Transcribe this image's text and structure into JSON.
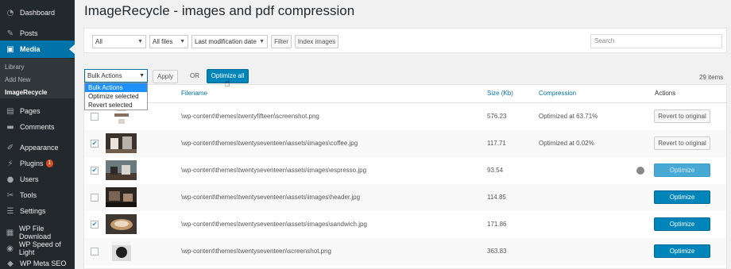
{
  "sidebar": {
    "items": [
      {
        "label": "Dashboard",
        "icon": "dashboard-icon",
        "glyph": "◔"
      },
      {
        "label": "Posts",
        "icon": "pushpin-icon",
        "glyph": "✎"
      },
      {
        "label": "Media",
        "icon": "media-icon",
        "glyph": "▣"
      },
      {
        "label": "Pages",
        "icon": "pages-icon",
        "glyph": "▤"
      },
      {
        "label": "Comments",
        "icon": "comments-icon",
        "glyph": "▬"
      },
      {
        "label": "Appearance",
        "icon": "paintbrush-icon",
        "glyph": "✐"
      },
      {
        "label": "Plugins",
        "icon": "plugins-icon",
        "glyph": "⚡",
        "badge": "1"
      },
      {
        "label": "Users",
        "icon": "users-icon",
        "glyph": "●"
      },
      {
        "label": "Tools",
        "icon": "tools-icon",
        "glyph": "✂"
      },
      {
        "label": "Settings",
        "icon": "settings-icon",
        "glyph": "☰"
      },
      {
        "label": "WP File Download",
        "icon": "download-icon",
        "glyph": "▦"
      },
      {
        "label": "WP Speed of Light",
        "icon": "speed-icon",
        "glyph": "◉"
      },
      {
        "label": "WP Meta SEO",
        "icon": "seo-icon",
        "glyph": "◆"
      }
    ],
    "submenu": [
      "Library",
      "Add New",
      "ImageRecycle"
    ]
  },
  "page_title": "ImageRecycle - images and pdf compression",
  "filters": {
    "type_select": "All",
    "files_select": "All files",
    "date_select": "Last modification date",
    "filter_button": "Filter",
    "index_button": "Index images",
    "search_placeholder": "Search"
  },
  "bulk": {
    "selected": "Bulk Actions",
    "options": [
      "Bulk Actions",
      "Optimize selected",
      "Revert selected"
    ],
    "apply": "Apply",
    "or": "OR",
    "optimize_all": "Optimize all",
    "items_count": "29 items"
  },
  "table": {
    "columns": {
      "filename": "Filename",
      "size": "Size (Kb)",
      "compression": "Compression",
      "actions": "Actions"
    },
    "rows": [
      {
        "checked": false,
        "filename": "\\wp-content\\themes\\twentyfifteen\\screenshot.png",
        "size": "576.23",
        "compression": "Optimized at 63.71%",
        "action": "Revert to original",
        "action_type": "revert",
        "thumb": "thumb-1"
      },
      {
        "checked": true,
        "filename": "\\wp-content\\themes\\twentyseventeen\\assets\\images\\coffee.jpg",
        "size": "117.71",
        "compression": "Optimized at 0.02%",
        "action": "Revert to original",
        "action_type": "revert",
        "thumb": "thumb-2"
      },
      {
        "checked": true,
        "filename": "\\wp-content\\themes\\twentyseventeen\\assets\\images\\espresso.jpg",
        "size": "93.54",
        "compression": "",
        "action": "Optimize",
        "action_type": "optimize-busy",
        "thumb": "thumb-3"
      },
      {
        "checked": false,
        "filename": "\\wp-content\\themes\\twentyseventeen\\assets\\images\\header.jpg",
        "size": "114.85",
        "compression": "",
        "action": "Optimize",
        "action_type": "optimize",
        "thumb": "thumb-4"
      },
      {
        "checked": true,
        "filename": "\\wp-content\\themes\\twentyseventeen\\assets\\images\\sandwich.jpg",
        "size": "171.86",
        "compression": "",
        "action": "Optimize",
        "action_type": "optimize",
        "thumb": "thumb-5"
      },
      {
        "checked": false,
        "filename": "\\wp-content\\themes\\twentyseventeen\\screenshot.png",
        "size": "363.83",
        "compression": "",
        "action": "Optimize",
        "action_type": "optimize",
        "thumb": "thumb-6"
      }
    ]
  },
  "colors": {
    "accent": "#0073aa",
    "button_primary": "#0085ba",
    "sidebar_bg": "#23282d"
  }
}
